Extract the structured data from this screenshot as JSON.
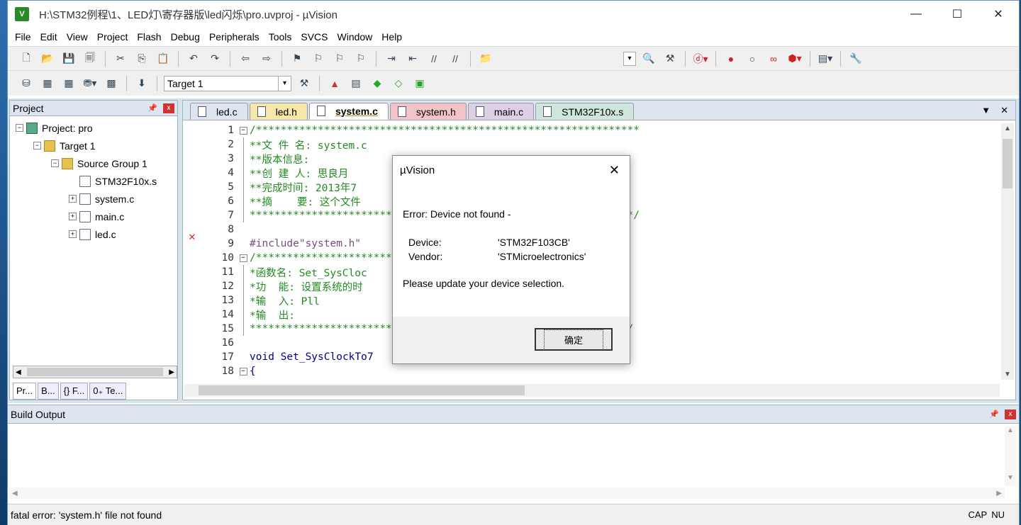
{
  "window": {
    "title": "H:\\STM32例程\\1、LED灯\\寄存器版\\led闪烁\\pro.uvproj - µVision",
    "minimize": "—",
    "maximize": "☐",
    "close": "✕",
    "app_icon": "V"
  },
  "menu": [
    "File",
    "Edit",
    "View",
    "Project",
    "Flash",
    "Debug",
    "Peripherals",
    "Tools",
    "SVCS",
    "Window",
    "Help"
  ],
  "toolbar2": {
    "target": "Target 1"
  },
  "project_panel": {
    "title": "Project",
    "pin": "📌",
    "close": "x",
    "tree": [
      {
        "label": "Project: pro",
        "level": 0,
        "expander": "−",
        "icon": "project-icon"
      },
      {
        "label": "Target 1",
        "level": 1,
        "expander": "−",
        "icon": "target-icon"
      },
      {
        "label": "Source Group 1",
        "level": 2,
        "expander": "−",
        "icon": "folder-icon"
      },
      {
        "label": "STM32F10x.s",
        "level": 3,
        "expander": "",
        "icon": "file-icon"
      },
      {
        "label": "system.c",
        "level": 3,
        "expander": "+",
        "icon": "file-icon"
      },
      {
        "label": "main.c",
        "level": 3,
        "expander": "+",
        "icon": "file-icon"
      },
      {
        "label": "led.c",
        "level": 3,
        "expander": "+",
        "icon": "file-icon"
      }
    ],
    "bottom_tabs": [
      "Pr...",
      "B...",
      "{} F...",
      "0₊ Te..."
    ]
  },
  "editor": {
    "tabs": [
      {
        "label": "led.c",
        "color": "#dde6f0",
        "active": false
      },
      {
        "label": "led.h",
        "color": "#f7e7a8",
        "active": false
      },
      {
        "label": "system.c",
        "color": "#e3ecb8",
        "active": true
      },
      {
        "label": "system.h",
        "color": "#f2c4c8",
        "active": false
      },
      {
        "label": "main.c",
        "color": "#dccfe6",
        "active": false
      },
      {
        "label": "STM32F10x.s",
        "color": "#cfe6dd",
        "active": false
      }
    ],
    "tab_menu": "▼",
    "tab_close": "✕",
    "error_marker": "✕",
    "lines": [
      {
        "n": "1",
        "fold": "box",
        "text": "/**************************************************************",
        "cls": ""
      },
      {
        "n": "2",
        "fold": "line",
        "text": "**文 件 名: system.c",
        "cls": ""
      },
      {
        "n": "3",
        "fold": "line",
        "text": "**版本信息:",
        "cls": ""
      },
      {
        "n": "4",
        "fold": "line",
        "text": "**创 建 人: 思良月",
        "cls": ""
      },
      {
        "n": "5",
        "fold": "line",
        "text": "**完成时间: 2013年7",
        "cls": ""
      },
      {
        "n": "6",
        "fold": "line",
        "text": "**摘    要: 这个文件                                      数",
        "cls": ""
      },
      {
        "n": "7",
        "fold": "line",
        "text": "**************************************************************/",
        "cls": ""
      },
      {
        "n": "8",
        "fold": "",
        "text": "",
        "cls": ""
      },
      {
        "n": "9",
        "fold": "",
        "text": "#include\"system.h\"",
        "cls": "pp"
      },
      {
        "n": "10",
        "fold": "box",
        "text": "/************************************************************",
        "cls": ""
      },
      {
        "n": "11",
        "fold": "line",
        "text": "*函数名: Set_SysCloc",
        "cls": ""
      },
      {
        "n": "12",
        "fold": "line",
        "text": "*功  能: 设置系统的时",
        "cls": ""
      },
      {
        "n": "13",
        "fold": "line",
        "text": "*输  入: Pll",
        "cls": ""
      },
      {
        "n": "14",
        "fold": "line",
        "text": "*输  出:",
        "cls": ""
      },
      {
        "n": "15",
        "fold": "line",
        "text": "*************************************************************/",
        "cls": ""
      },
      {
        "n": "16",
        "fold": "",
        "text": "",
        "cls": ""
      },
      {
        "n": "17",
        "fold": "",
        "text": "void Set_SysClockTo7",
        "cls": "kw"
      },
      {
        "n": "18",
        "fold": "box",
        "text": "{",
        "cls": "kw"
      }
    ]
  },
  "build_output": {
    "title": "Build Output",
    "pin": "📌",
    "close": "x"
  },
  "status": {
    "message": "fatal error: 'system.h' file not found",
    "cap": "CAP",
    "num": "NU"
  },
  "dialog": {
    "title": "µVision",
    "close": "✕",
    "error": "Error: Device not found -",
    "device_label": "Device:",
    "device_value": "'STM32F103CB'",
    "vendor_label": "Vendor:",
    "vendor_value": "'STMicroelectronics'",
    "message": "Please update your device selection.",
    "ok": "确定"
  }
}
